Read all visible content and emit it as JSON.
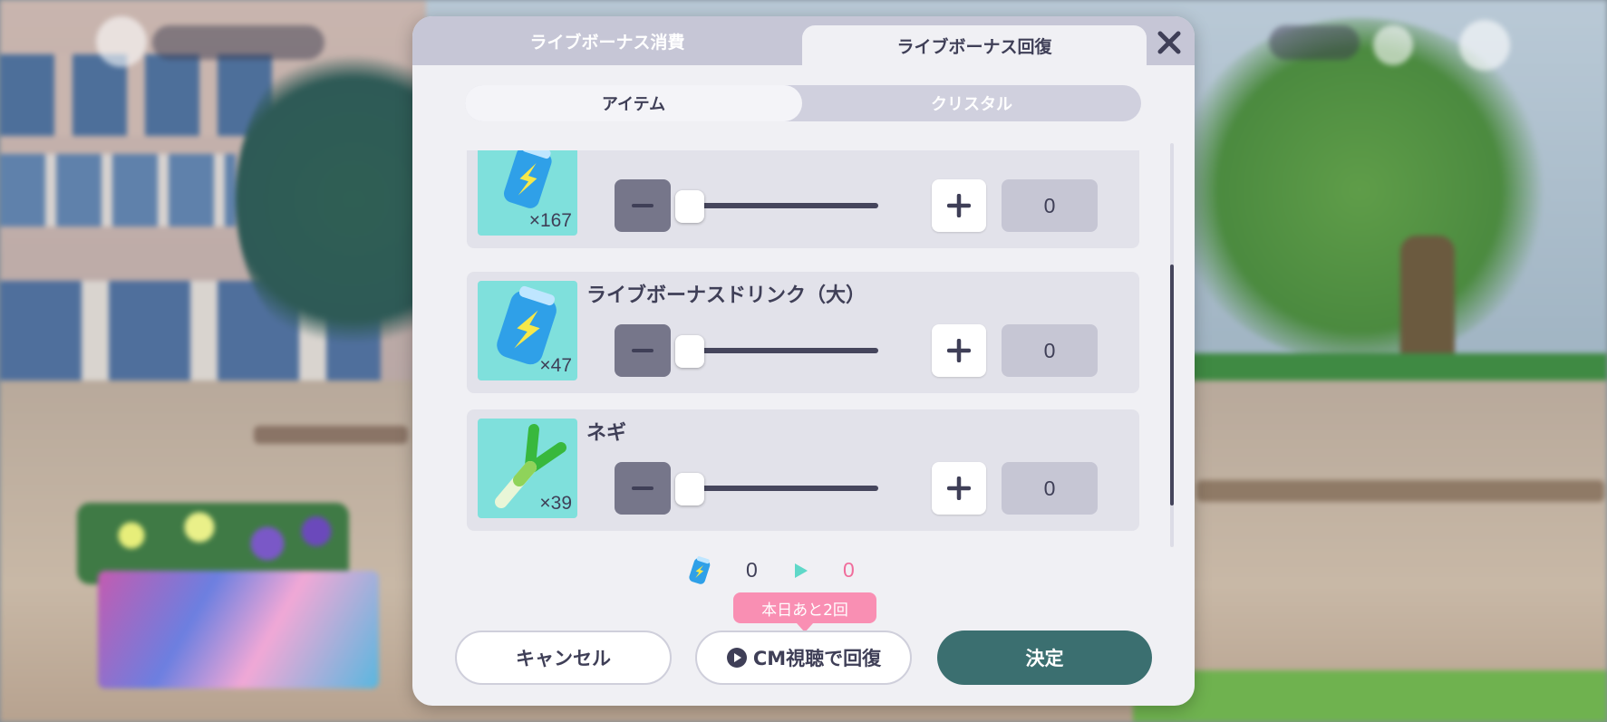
{
  "dialog": {
    "tabs": [
      {
        "label": "ライブボーナス消費",
        "active": false
      },
      {
        "label": "ライブボーナス回復",
        "active": true
      }
    ],
    "close_icon": "close-icon",
    "subtabs": [
      {
        "label": "アイテム",
        "active": true
      },
      {
        "label": "クリスタル",
        "active": false
      }
    ]
  },
  "items": [
    {
      "name": "",
      "icon": "live-bonus-drink-icon",
      "count": "×167",
      "quantity": "0"
    },
    {
      "name": "ライブボーナスドリンク（大）",
      "icon": "live-bonus-drink-large-icon",
      "count": "×47",
      "quantity": "0"
    },
    {
      "name": "ネギ",
      "icon": "green-onion-icon",
      "count": "×39",
      "quantity": "0"
    }
  ],
  "summary": {
    "icon": "live-bonus-drink-icon",
    "before": "0",
    "after": "0"
  },
  "tooltip": "本日あと2回",
  "buttons": {
    "cancel": "キャンセル",
    "cm": "CM視聴で回復",
    "confirm": "決定"
  },
  "colors": {
    "accent_teal": "#3b6f70",
    "pink": "#f98fb3",
    "item_bg": "#7fe0dc"
  }
}
